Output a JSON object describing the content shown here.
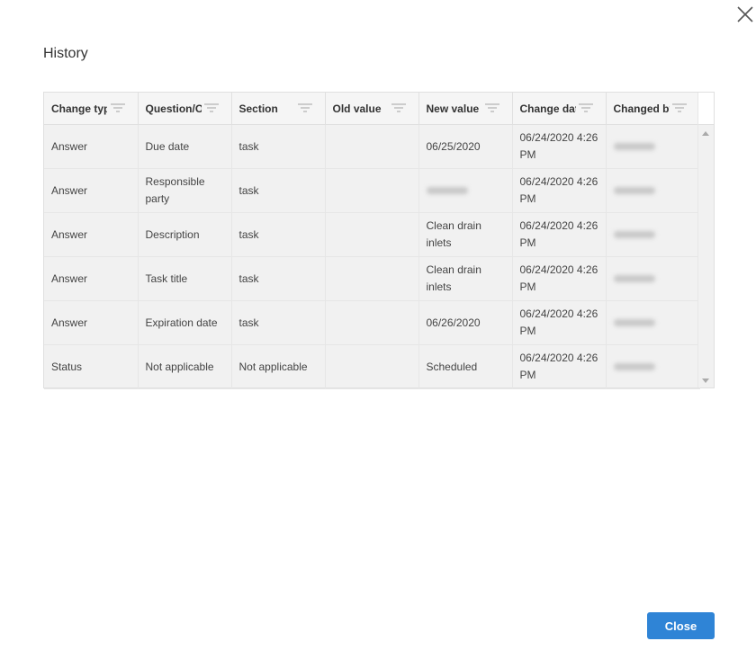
{
  "dialog": {
    "title": "History",
    "close_label": "Close"
  },
  "table": {
    "columns": [
      "Change type",
      "Question/O",
      "Section",
      "Old value",
      "New value",
      "Change date",
      "Changed by"
    ],
    "rows": [
      [
        "Answer",
        "Due date",
        "task",
        "",
        "06/25/2020",
        "06/24/2020 4:26 PM",
        null
      ],
      [
        "Answer",
        "Responsible party",
        "task",
        "",
        null,
        "06/24/2020 4:26 PM",
        null
      ],
      [
        "Answer",
        "Description",
        "task",
        "",
        "Clean drain inlets",
        "06/24/2020 4:26 PM",
        null
      ],
      [
        "Answer",
        "Task title",
        "task",
        "",
        "Clean drain inlets",
        "06/24/2020 4:26 PM",
        null
      ],
      [
        "Answer",
        "Expiration date",
        "task",
        "",
        "06/26/2020",
        "06/24/2020 4:26 PM",
        null
      ],
      [
        "Status",
        "Not applicable",
        "Not applicable",
        "",
        "Scheduled",
        "06/24/2020 4:26 PM",
        null
      ]
    ]
  },
  "colors": {
    "accent": "#2f84d6"
  }
}
